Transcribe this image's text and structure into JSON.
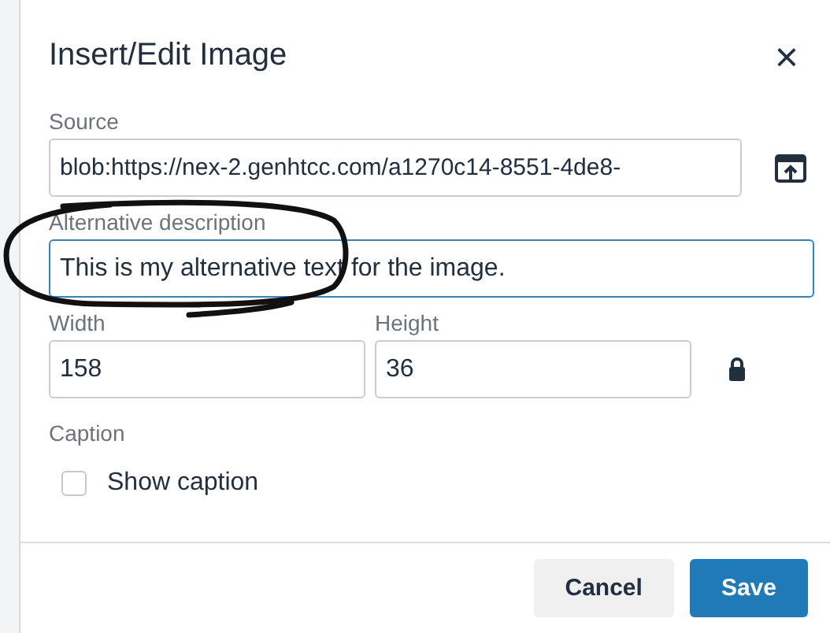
{
  "dialog": {
    "title": "Insert/Edit Image",
    "close": "×"
  },
  "source": {
    "label": "Source",
    "value": "blob:https://nex-2.genhtcc.com/a1270c14-8551-4de8-"
  },
  "alt": {
    "label": "Alternative description",
    "value": "This is my alternative text for the image.",
    "focused": true
  },
  "width": {
    "label": "Width",
    "value": "158"
  },
  "height": {
    "label": "Height",
    "value": "36"
  },
  "caption": {
    "label": "Caption",
    "option": "Show caption",
    "checked": false
  },
  "buttons": [
    {
      "label": "Cancel",
      "kind": "secondary"
    },
    {
      "label": "Save",
      "kind": "primary"
    }
  ]
}
